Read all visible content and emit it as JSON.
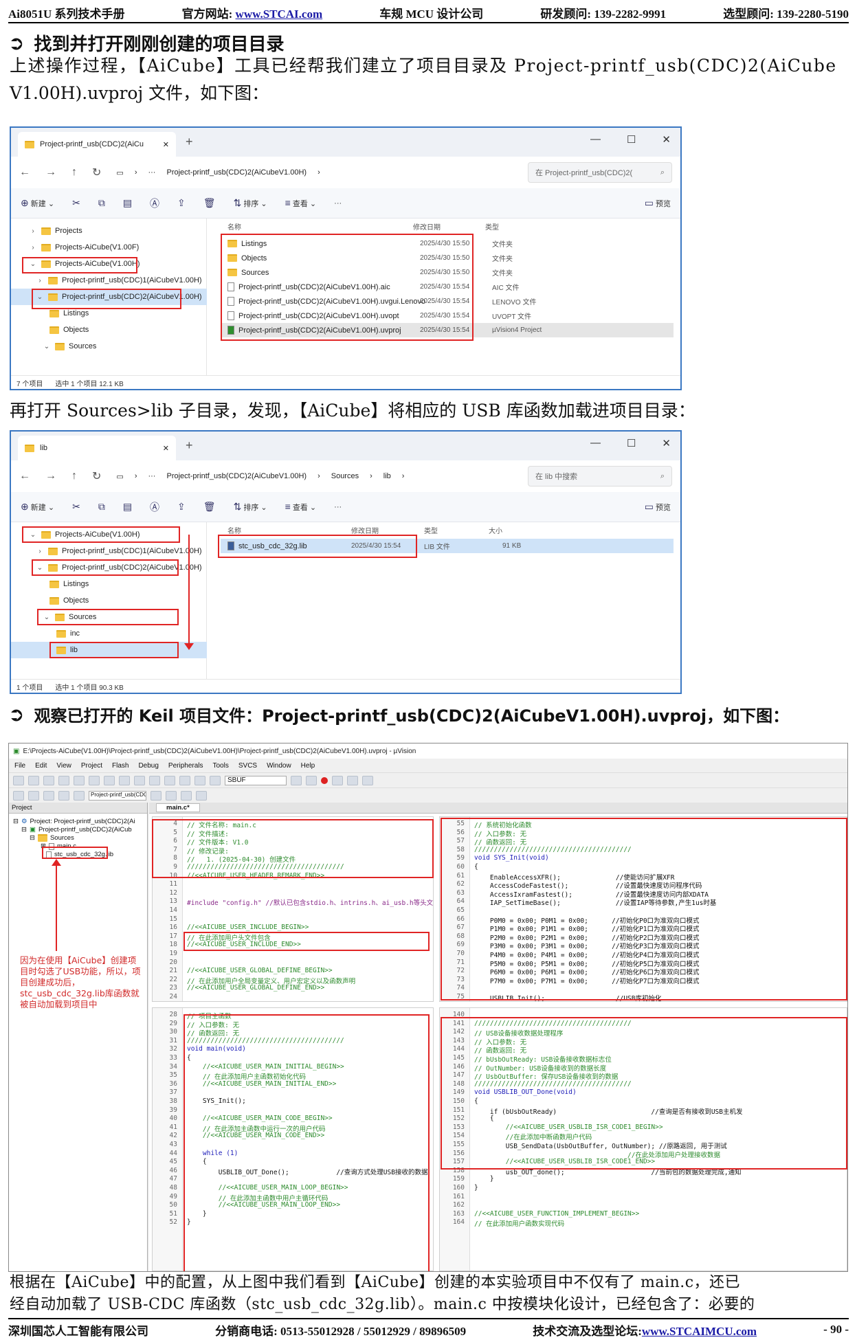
{
  "header": {
    "manual": "Ai8051U 系列技术手册",
    "site_label": "官方网站: ",
    "site_url": "www.STCAI.com",
    "company": "车规 MCU 设计公司",
    "rd": "研发顾问: 139-2282-9991",
    "sel": "选型顾问: 139-2280-5190"
  },
  "section1": {
    "title": "找到并打开刚刚创建的项目目录",
    "para_l1": "上述操作过程，【AiCube】工具已经帮我们建立了项目目录及 Project-printf_usb(CDC)2(AiCube",
    "para_l2": "V1.00H).uvproj 文件，如下图："
  },
  "explorer1": {
    "tab": "Project-printf_usb(CDC)2(AiCu",
    "path": "Project-printf_usb(CDC)2(AiCubeV1.00H)",
    "search": "在 Project-printf_usb(CDC)2(",
    "toolbar": {
      "new": "新建",
      "sort": "排序",
      "view": "查看",
      "preview": "预览"
    },
    "nav": [
      "Projects",
      "Projects-AiCube(V1.00F)",
      "Projects-AiCube(V1.00H)",
      "Project-printf_usb(CDC)1(AiCubeV1.00H)",
      "Project-printf_usb(CDC)2(AiCubeV1.00H)",
      "Listings",
      "Objects",
      "Sources"
    ],
    "cols": {
      "name": "名称",
      "date": "修改日期",
      "type": "类型"
    },
    "files": [
      {
        "name": "Listings",
        "date": "2025/4/30 15:50",
        "type": "文件夹"
      },
      {
        "name": "Objects",
        "date": "2025/4/30 15:50",
        "type": "文件夹"
      },
      {
        "name": "Sources",
        "date": "2025/4/30 15:50",
        "type": "文件夹"
      },
      {
        "name": "Project-printf_usb(CDC)2(AiCubeV1.00H).aic",
        "date": "2025/4/30 15:54",
        "type": "AIC 文件"
      },
      {
        "name": "Project-printf_usb(CDC)2(AiCubeV1.00H).uvgui.Lenovo",
        "date": "2025/4/30 15:54",
        "type": "LENOVO 文件"
      },
      {
        "name": "Project-printf_usb(CDC)2(AiCubeV1.00H).uvopt",
        "date": "2025/4/30 15:54",
        "type": "UVOPT 文件"
      },
      {
        "name": "Project-printf_usb(CDC)2(AiCubeV1.00H).uvproj",
        "date": "2025/4/30 15:54",
        "type": "µVision4 Project"
      }
    ],
    "status_count": "7 个项目",
    "status_sel": "选中 1 个项目  12.1 KB"
  },
  "para2": "再打开 Sources>lib 子目录，发现，【AiCube】将相应的 USB 库函数加载进项目目录：",
  "explorer2": {
    "tab": "lib",
    "path1": "Project-printf_usb(CDC)2(AiCubeV1.00H)",
    "path2": "Sources",
    "path3": "lib",
    "search": "在 lib 中搜索",
    "toolbar": {
      "new": "新建",
      "sort": "排序",
      "view": "查看",
      "preview": "预览"
    },
    "nav": [
      "Projects-AiCube(V1.00H)",
      "Project-printf_usb(CDC)1(AiCubeV1.00H)",
      "Project-printf_usb(CDC)2(AiCubeV1.00H)",
      "Listings",
      "Objects",
      "Sources",
      "inc",
      "lib"
    ],
    "cols": {
      "name": "名称",
      "date": "修改日期",
      "type": "类型",
      "size": "大小"
    },
    "file": {
      "name": "stc_usb_cdc_32g.lib",
      "date": "2025/4/30 15:54",
      "type": "LIB 文件",
      "size": "91 KB"
    },
    "status_count": "1 个项目",
    "status_sel": "选中 1 个项目  90.3 KB"
  },
  "section2": {
    "title": "观察已打开的 Keil 项目文件：Project-printf_usb(CDC)2(AiCubeV1.00H).uvproj，如下图："
  },
  "keil": {
    "title": "E:\\Projects-AiCube(V1.00H)\\Project-printf_usb(CDC)2(AiCubeV1.00H)\\Project-printf_usb(CDC)2(AiCubeV1.00H).uvproj - µVision",
    "menu": [
      "File",
      "Edit",
      "View",
      "Project",
      "Flash",
      "Debug",
      "Peripherals",
      "Tools",
      "SVCS",
      "Window",
      "Help"
    ],
    "target": "Project-printf_usb(CDC2",
    "sbuf": "SBUF",
    "project_header": "Project",
    "tree": [
      "Project: Project-printf_usb(CDC)2(Ai",
      "Project-printf_usb(CDC)2(AiCub",
      "Sources",
      "main.c",
      "stc_usb_cdc_32g.lib"
    ],
    "tab": "main.c*",
    "note": "因为在使用【AiCube】创建项目时勾选了USB功能，所以，项目创建成功后，stc_usb_cdc_32g.lib库函数就被自动加载到项目中",
    "pane1": [
      [
        "4",
        "// 文件名称: main.c",
        "com"
      ],
      [
        "5",
        "// 文件描述:",
        "com"
      ],
      [
        "6",
        "// 文件版本: V1.0",
        "com"
      ],
      [
        "7",
        "// 修改记录:",
        "com"
      ],
      [
        "8",
        "//   1. (2025-04-30) 创建文件",
        "com"
      ],
      [
        "9",
        "////////////////////////////////////////",
        "com"
      ],
      [
        "10",
        "//<<AICUBE_USER_HEADER_REMARK_END>>",
        "com"
      ],
      [
        "11",
        "",
        "txt"
      ],
      [
        "12",
        "",
        "txt"
      ],
      [
        "13",
        "#include \"config.h\" //默认已包含stdio.h、intrins.h、ai_usb.h等头文件",
        "pp"
      ],
      [
        "14",
        "",
        "txt"
      ],
      [
        "15",
        "",
        "txt"
      ],
      [
        "16",
        "//<<AICUBE_USER_INCLUDE_BEGIN>>",
        "com"
      ],
      [
        "17",
        "// 在此添加用户头文件包含",
        "com"
      ],
      [
        "18",
        "//<<AICUBE_USER_INCLUDE_END>>",
        "com"
      ],
      [
        "19",
        "",
        "txt"
      ],
      [
        "20",
        "",
        "txt"
      ],
      [
        "21",
        "//<<AICUBE_USER_GLOBAL_DEFINE_BEGIN>>",
        "com"
      ],
      [
        "22",
        "// 在此添加用户全局变量定义、用户宏定义以及函数声明",
        "com"
      ],
      [
        "23",
        "//<<AICUBE_USER_GLOBAL_DEFINE_END>>",
        "com"
      ],
      [
        "24",
        "",
        "txt"
      ]
    ],
    "pane2": [
      [
        "55",
        "// 系统初始化函数",
        "com"
      ],
      [
        "56",
        "// 入口参数: 无",
        "com"
      ],
      [
        "57",
        "// 函数返回: 无",
        "com"
      ],
      [
        "58",
        "////////////////////////////////////////",
        "com"
      ],
      [
        "59",
        "void SYS_Init(void)",
        "kw"
      ],
      [
        "60",
        "{",
        "txt"
      ],
      [
        "61",
        "    EnableAccessXFR();              //使能访问扩展XFR",
        "txt"
      ],
      [
        "62",
        "    AccessCodeFastest();            //设置最快速度访问程序代码",
        "txt"
      ],
      [
        "63",
        "    AccessIxramFastest();           //设置最快速度访问内部XDATA",
        "txt"
      ],
      [
        "64",
        "    IAP_SetTimeBase();              //设置IAP等待参数,产生1us时基",
        "txt"
      ],
      [
        "65",
        "",
        "txt"
      ],
      [
        "66",
        "    P0M0 = 0x00; P0M1 = 0x00;      //初始化P0口为准双向口模式",
        "txt"
      ],
      [
        "67",
        "    P1M0 = 0x00; P1M1 = 0x00;      //初始化P1口为准双向口模式",
        "txt"
      ],
      [
        "68",
        "    P2M0 = 0x00; P2M1 = 0x00;      //初始化P2口为准双向口模式",
        "txt"
      ],
      [
        "69",
        "    P3M0 = 0x00; P3M1 = 0x00;      //初始化P3口为准双向口模式",
        "txt"
      ],
      [
        "70",
        "    P4M0 = 0x00; P4M1 = 0x00;      //初始化P4口为准双向口模式",
        "txt"
      ],
      [
        "71",
        "    P5M0 = 0x00; P5M1 = 0x00;      //初始化P5口为准双向口模式",
        "txt"
      ],
      [
        "72",
        "    P6M0 = 0x00; P6M1 = 0x00;      //初始化P6口为准双向口模式",
        "txt"
      ],
      [
        "73",
        "    P7M0 = 0x00; P7M1 = 0x00;      //初始化P7口为准双向口模式",
        "txt"
      ],
      [
        "74",
        "",
        "txt"
      ],
      [
        "75",
        "    USBLIB_Init();                  //USB库初始化",
        "txt"
      ]
    ],
    "pane3": [
      [
        "28",
        "// 项目主函数",
        "com"
      ],
      [
        "29",
        "// 入口参数: 无",
        "com"
      ],
      [
        "30",
        "// 函数返回: 无",
        "com"
      ],
      [
        "31",
        "////////////////////////////////////////",
        "com"
      ],
      [
        "32",
        "void main(void)",
        "kw"
      ],
      [
        "33",
        "{",
        "txt"
      ],
      [
        "34",
        "    //<<AICUBE_USER_MAIN_INITIAL_BEGIN>>",
        "com"
      ],
      [
        "35",
        "    // 在此添加用户主函数初始化代码",
        "com"
      ],
      [
        "36",
        "    //<<AICUBE_USER_MAIN_INITIAL_END>>",
        "com"
      ],
      [
        "37",
        "",
        "txt"
      ],
      [
        "38",
        "    SYS_Init();",
        "txt"
      ],
      [
        "39",
        "",
        "txt"
      ],
      [
        "40",
        "    //<<AICUBE_USER_MAIN_CODE_BEGIN>>",
        "com"
      ],
      [
        "41",
        "    // 在此添加主函数中运行一次的用户代码",
        "com"
      ],
      [
        "42",
        "    //<<AICUBE_USER_MAIN_CODE_END>>",
        "com"
      ],
      [
        "43",
        "",
        "txt"
      ],
      [
        "44",
        "    while (1)",
        "kw"
      ],
      [
        "45",
        "    {",
        "txt"
      ],
      [
        "46",
        "        USBLIB_OUT_Done();            //查询方式处理USB接收的数据",
        "txt"
      ],
      [
        "47",
        "",
        "txt"
      ],
      [
        "48",
        "        //<<AICUBE_USER_MAIN_LOOP_BEGIN>>",
        "com"
      ],
      [
        "49",
        "        // 在此添加主函数中用户主循环代码",
        "com"
      ],
      [
        "50",
        "        //<<AICUBE_USER_MAIN_LOOP_END>>",
        "com"
      ],
      [
        "51",
        "    }",
        "txt"
      ],
      [
        "52",
        "}",
        "txt"
      ]
    ],
    "pane4": [
      [
        "140",
        "",
        "txt"
      ],
      [
        "141",
        "////////////////////////////////////////",
        "com"
      ],
      [
        "142",
        "// USB设备接收数据处理程序",
        "com"
      ],
      [
        "143",
        "// 入口参数: 无",
        "com"
      ],
      [
        "144",
        "// 函数返回: 无",
        "com"
      ],
      [
        "145",
        "// bUsbOutReady: USB设备接收数据标志位",
        "com"
      ],
      [
        "146",
        "// OutNumber: USB设备接收到的数据长度",
        "com"
      ],
      [
        "147",
        "// UsbOutBuffer: 保存USB设备接收到的数据",
        "com"
      ],
      [
        "148",
        "////////////////////////////////////////",
        "com"
      ],
      [
        "149",
        "void USBLIB_OUT_Done(void)",
        "kw"
      ],
      [
        "150",
        "{",
        "txt"
      ],
      [
        "151",
        "    if (bUsbOutReady)                        //查询是否有接收到USB主机发",
        "txt"
      ],
      [
        "152",
        "    {",
        "txt"
      ],
      [
        "153",
        "        //<<AICUBE_USER_USBLIB_ISR_CODE1_BEGIN>>",
        "com"
      ],
      [
        "154",
        "        //在此添加中断函数用户代码",
        "com"
      ],
      [
        "155",
        "        USB_SendData(UsbOutBuffer, OutNumber); //原路返回, 用于测试",
        "txt"
      ],
      [
        "156",
        "                                       //在此处添加用户处理接收数据",
        "com"
      ],
      [
        "157",
        "        //<<AICUBE_USER_USBLIB_ISR_CODE1_END>>",
        "com"
      ],
      [
        "158",
        "        usb_OUT_done();                      //当前包的数据处理完成,通知",
        "txt"
      ],
      [
        "159",
        "    }",
        "txt"
      ],
      [
        "160",
        "}",
        "txt"
      ],
      [
        "161",
        "",
        "txt"
      ],
      [
        "162",
        "",
        "txt"
      ],
      [
        "163",
        "//<<AICUBE_USER_FUNCTION_IMPLEMENT_BEGIN>>",
        "com"
      ],
      [
        "164",
        "// 在此添加用户函数实现代码",
        "com"
      ]
    ]
  },
  "para3_l1": "根据在【AiCube】中的配置，从上图中我们看到【AiCube】创建的本实验项目中不仅有了 main.c，还已",
  "para3_l2": "经自动加载了 USB-CDC 库函数（stc_usb_cdc_32g.lib）。main.c 中按模块化设计，已经包含了：必要的",
  "footer": {
    "company": "深圳国芯人工智能有限公司",
    "phone": "分销商电话: 0513-55012928 / 55012929 / 89896509",
    "forum_label": "技术交流及选型论坛:",
    "forum_url": "www.STCAIMCU.com",
    "page": "- 90 -"
  }
}
